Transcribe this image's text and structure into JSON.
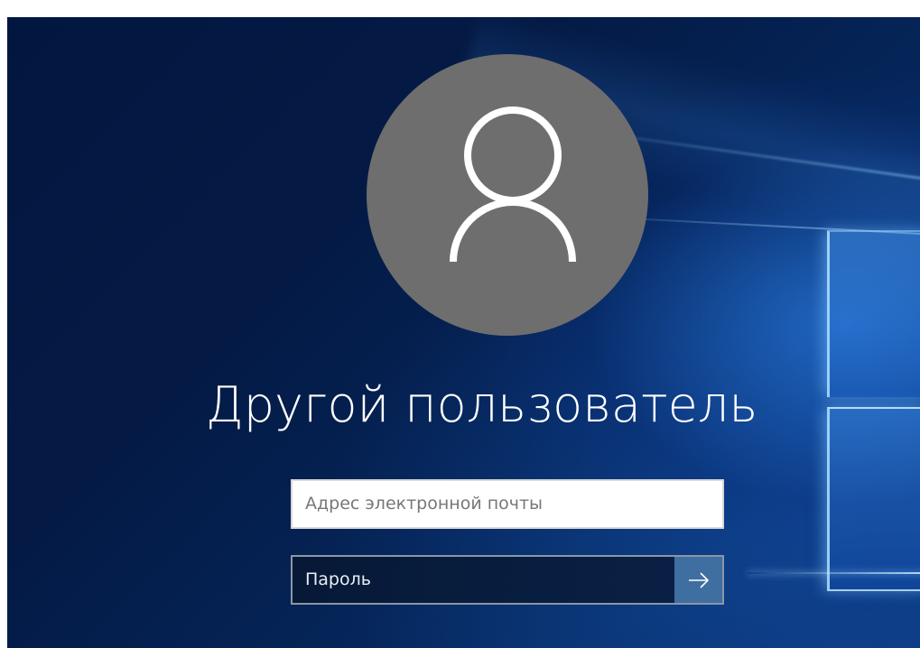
{
  "login": {
    "avatar_icon": "user-icon",
    "username": "Другой пользователь",
    "email_placeholder": "Адрес электронной почты",
    "password_placeholder": "Пароль",
    "submit_icon": "arrow-right-icon"
  },
  "colors": {
    "background": "#041a45",
    "avatar_circle": "#6e6e6e",
    "submit_button": "#3f6ea0",
    "text": "#ffffff"
  }
}
